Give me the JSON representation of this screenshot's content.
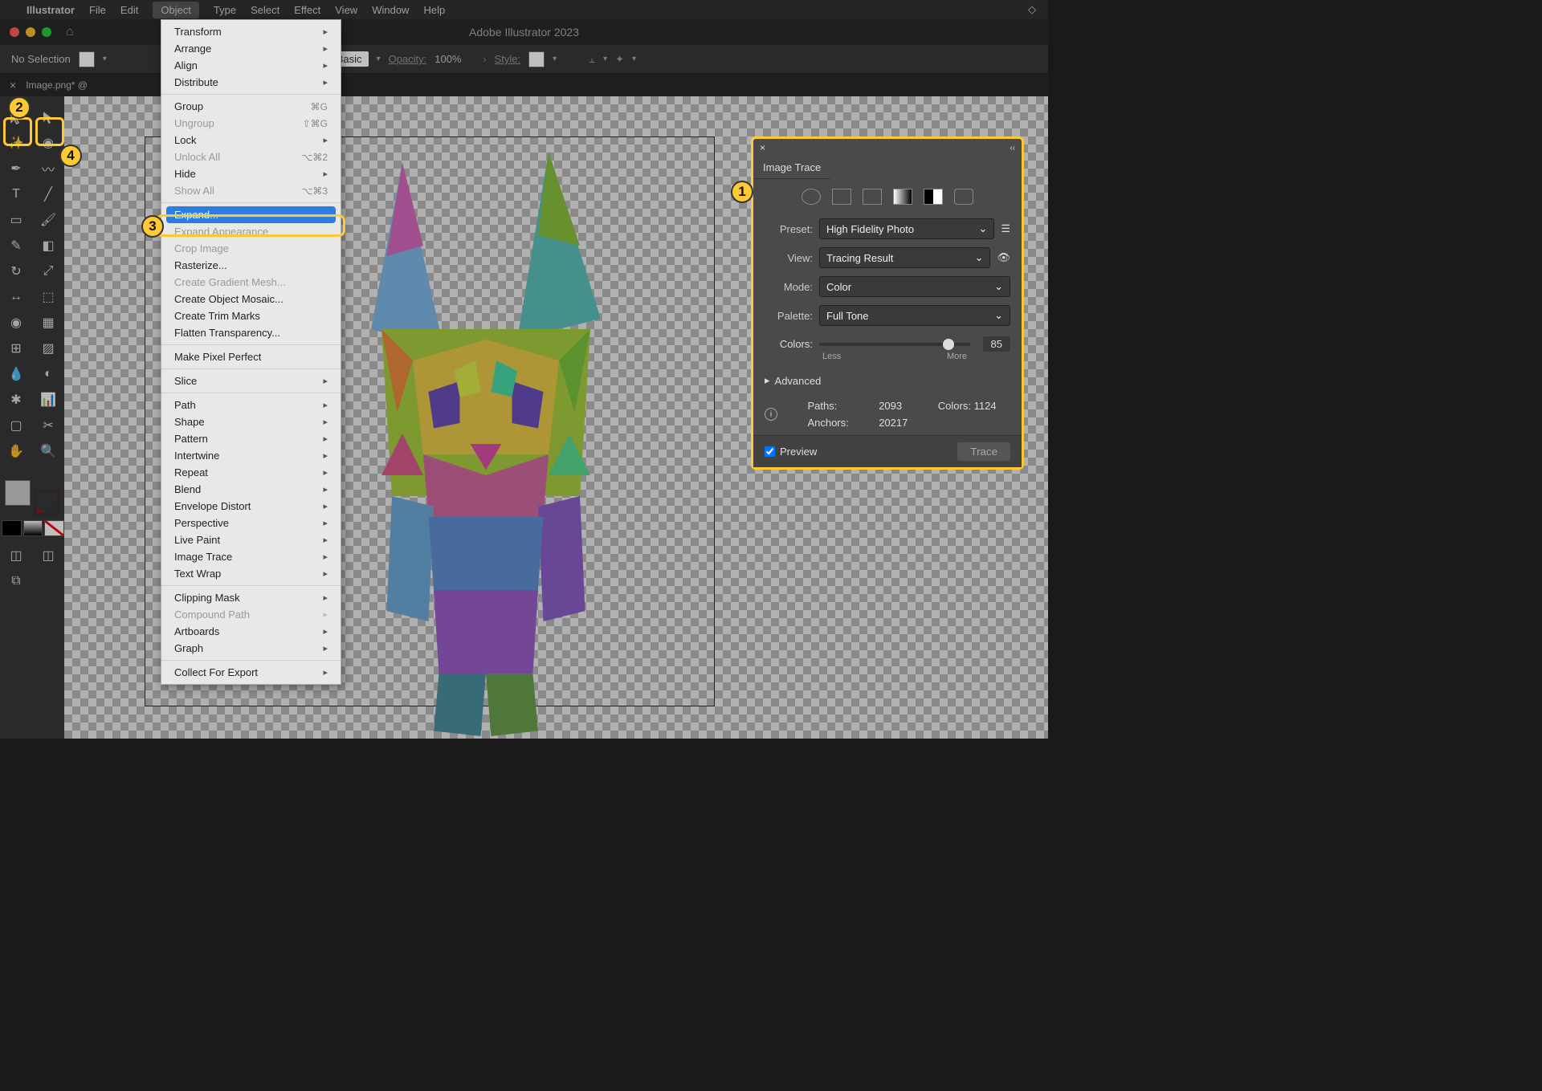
{
  "menubar": {
    "app": "Illustrator",
    "items": [
      "File",
      "Edit",
      "Object",
      "Type",
      "Select",
      "Effect",
      "View",
      "Window",
      "Help"
    ],
    "active": "Object"
  },
  "titlebar": {
    "title": "Adobe Illustrator 2023"
  },
  "controlbar": {
    "selection": "No Selection",
    "stroke_style": "Basic",
    "opacity_label": "Opacity:",
    "opacity": "100%",
    "style_label": "Style:"
  },
  "tabbar": {
    "filename": "Image.png* @"
  },
  "menu": {
    "items": [
      {
        "label": "Transform",
        "sub": true
      },
      {
        "label": "Arrange",
        "sub": true
      },
      {
        "label": "Align",
        "sub": true
      },
      {
        "label": "Distribute",
        "sub": true
      },
      {
        "sep": true
      },
      {
        "label": "Group",
        "shortcut": "⌘G"
      },
      {
        "label": "Ungroup",
        "shortcut": "⇧⌘G",
        "disabled": true
      },
      {
        "label": "Lock",
        "sub": true
      },
      {
        "label": "Unlock All",
        "shortcut": "⌥⌘2",
        "disabled": true
      },
      {
        "label": "Hide",
        "sub": true
      },
      {
        "label": "Show All",
        "shortcut": "⌥⌘3",
        "disabled": true
      },
      {
        "sep": true
      },
      {
        "label": "Expand...",
        "highlighted": true
      },
      {
        "label": "Expand Appearance",
        "disabled": true
      },
      {
        "label": "Crop Image",
        "disabled": true
      },
      {
        "label": "Rasterize..."
      },
      {
        "label": "Create Gradient Mesh...",
        "disabled": true
      },
      {
        "label": "Create Object Mosaic..."
      },
      {
        "label": "Create Trim Marks"
      },
      {
        "label": "Flatten Transparency..."
      },
      {
        "sep": true
      },
      {
        "label": "Make Pixel Perfect"
      },
      {
        "sep": true
      },
      {
        "label": "Slice",
        "sub": true
      },
      {
        "sep": true
      },
      {
        "label": "Path",
        "sub": true
      },
      {
        "label": "Shape",
        "sub": true
      },
      {
        "label": "Pattern",
        "sub": true
      },
      {
        "label": "Intertwine",
        "sub": true
      },
      {
        "label": "Repeat",
        "sub": true
      },
      {
        "label": "Blend",
        "sub": true
      },
      {
        "label": "Envelope Distort",
        "sub": true
      },
      {
        "label": "Perspective",
        "sub": true
      },
      {
        "label": "Live Paint",
        "sub": true
      },
      {
        "label": "Image Trace",
        "sub": true
      },
      {
        "label": "Text Wrap",
        "sub": true
      },
      {
        "sep": true
      },
      {
        "label": "Clipping Mask",
        "sub": true
      },
      {
        "label": "Compound Path",
        "sub": true,
        "disabled": true
      },
      {
        "label": "Artboards",
        "sub": true
      },
      {
        "label": "Graph",
        "sub": true
      },
      {
        "sep": true
      },
      {
        "label": "Collect For Export",
        "sub": true
      }
    ]
  },
  "panel": {
    "title": "Image Trace",
    "preset_label": "Preset:",
    "preset": "High Fidelity Photo",
    "view_label": "View:",
    "view": "Tracing Result",
    "mode_label": "Mode:",
    "mode": "Color",
    "palette_label": "Palette:",
    "palette": "Full Tone",
    "colors_label": "Colors:",
    "colors_value": "85",
    "less": "Less",
    "more": "More",
    "advanced": "Advanced",
    "paths_label": "Paths:",
    "paths_value": "2093",
    "colors_stat_label": "Colors:",
    "colors_stat_value": "1124",
    "anchors_label": "Anchors:",
    "anchors_value": "20217",
    "preview": "Preview",
    "trace": "Trace"
  },
  "callouts": {
    "c1": "1",
    "c2": "2",
    "c3": "3",
    "c4": "4"
  }
}
